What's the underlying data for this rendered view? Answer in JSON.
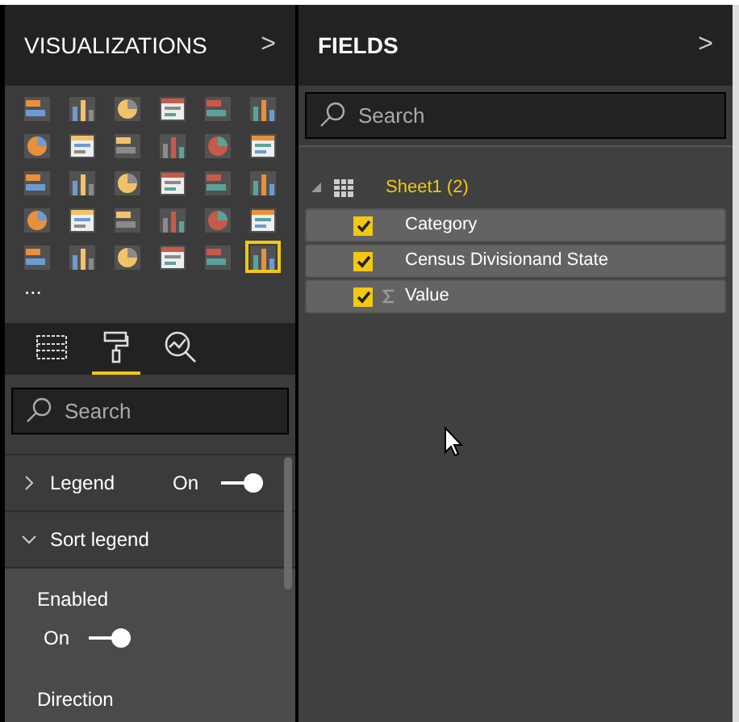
{
  "visualizations_pane": {
    "title": "VISUALIZATIONS",
    "collapse": ">",
    "visuals": [
      {
        "selected": false
      },
      {
        "selected": false
      },
      {
        "selected": false
      },
      {
        "selected": false
      },
      {
        "selected": false
      },
      {
        "selected": false
      },
      {
        "selected": false
      },
      {
        "selected": false
      },
      {
        "selected": false
      },
      {
        "selected": false
      },
      {
        "selected": false
      },
      {
        "selected": false
      },
      {
        "selected": false
      },
      {
        "selected": false
      },
      {
        "selected": false
      },
      {
        "selected": false
      },
      {
        "selected": false
      },
      {
        "selected": false
      },
      {
        "selected": false
      },
      {
        "selected": false
      },
      {
        "selected": false
      },
      {
        "selected": false
      },
      {
        "selected": false
      },
      {
        "selected": false
      },
      {
        "selected": false
      },
      {
        "selected": false
      },
      {
        "selected": false
      },
      {
        "selected": false
      },
      {
        "selected": false
      },
      {
        "selected": true
      }
    ],
    "more": "...",
    "tabs": [
      {
        "kind": "fields",
        "selected": false
      },
      {
        "kind": "format",
        "selected": true
      },
      {
        "kind": "analytics",
        "selected": false
      }
    ],
    "search": {
      "placeholder": "Search"
    },
    "sections": [
      {
        "label": "Legend",
        "expanded": false,
        "toggle": {
          "text": "On",
          "on": true
        }
      },
      {
        "label": "Sort legend",
        "expanded": true
      }
    ],
    "settings": [
      {
        "kind": "toggle",
        "label": "Enabled",
        "text": "On",
        "on": true
      },
      {
        "kind": "label",
        "label": "Direction"
      }
    ]
  },
  "fields_pane": {
    "title": "FIELDS",
    "collapse": ">",
    "search": {
      "placeholder": "Search"
    },
    "table": {
      "name": "Sheet1 (2)",
      "expanded": true,
      "fields": [
        {
          "name": "Category",
          "checked": true,
          "sigma": false
        },
        {
          "name": "Census Divisionand State",
          "checked": true,
          "sigma": false
        },
        {
          "name": "Value",
          "checked": true,
          "sigma": true
        }
      ]
    }
  }
}
